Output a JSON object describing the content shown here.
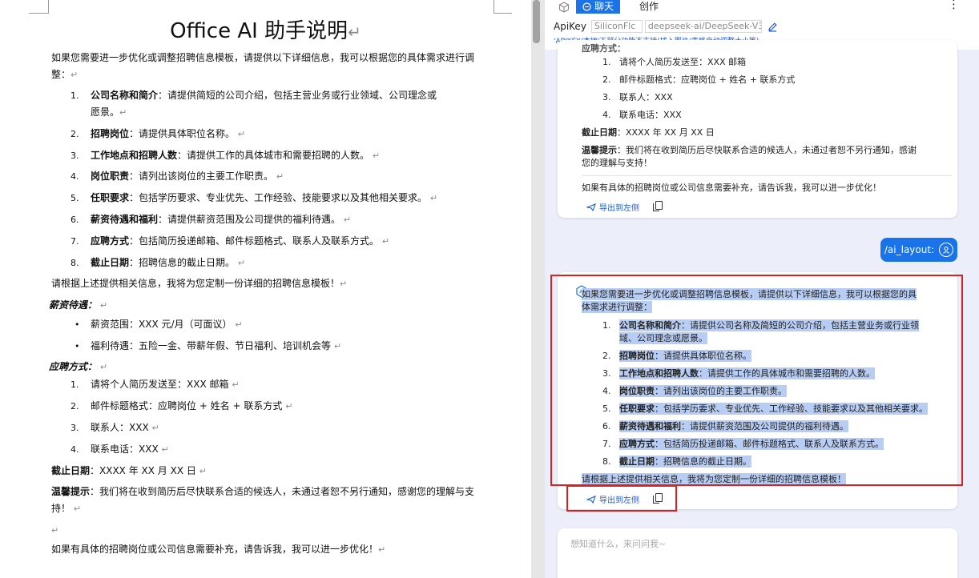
{
  "document": {
    "title": "Office AI 助手说明",
    "intro_1": "如果您需要进一步优化或调整招聘信息模板，请提供以下详细信息，我可以根据您的具体需求进行调",
    "intro_2": "整：",
    "items": [
      {
        "num": "1.",
        "label": "公司名称和简介",
        "text": "：请提供简短的公司介绍，包括主营业务或行业领域、公司理念或",
        "text2": "愿景。"
      },
      {
        "num": "2.",
        "label": "招聘岗位",
        "text": "：请提供具体职位名称。"
      },
      {
        "num": "3.",
        "label": "工作地点和招聘人数",
        "text": "：请提供工作的具体城市和需要招聘的人数。"
      },
      {
        "num": "4.",
        "label": "岗位职责",
        "text": "：请列出该岗位的主要工作职责。"
      },
      {
        "num": "5.",
        "label": "任职要求",
        "text": "：包括学历要求、专业优先、工作经验、技能要求以及其他相关要求。"
      },
      {
        "num": "6.",
        "label": "薪资待遇和福利",
        "text": "：请提供薪资范围及公司提供的福利待遇。"
      },
      {
        "num": "7.",
        "label": "应聘方式",
        "text": "：包括简历投递邮箱、邮件标题格式、联系人及联系方式。"
      },
      {
        "num": "8.",
        "label": "截止日期",
        "text": "：招聘信息的截止日期。"
      }
    ],
    "closing": "请根据上述提供相关信息，我将为您定制一份详细的招聘信息模板！",
    "salary_heading": "薪资待遇：",
    "salary_bullets": [
      {
        "mark": "•",
        "text": "薪资范围：XXX 元/月（可面议）"
      },
      {
        "mark": "•",
        "text": "福利待遇：五险一金、带薪年假、节日福利、培训机会等"
      }
    ],
    "apply_heading": "应聘方式：",
    "apply_items": [
      {
        "num": "1.",
        "text": "请将个人简历发送至：XXX 邮箱"
      },
      {
        "num": "2.",
        "text": "邮件标题格式：应聘岗位 + 姓名 + 联系方式"
      },
      {
        "num": "3.",
        "text": "联系人：XXX"
      },
      {
        "num": "4.",
        "text": "联系电话：XXX"
      }
    ],
    "deadline_label": "截止日期",
    "deadline_text": "：XXXX 年 XX 月 XX 日",
    "reminder_label": "温馨提示",
    "reminder_text": "：我们将在收到简历后尽快联系合适的候选人，未通过者恕不另行通知，感谢您的理解与支",
    "reminder_text2": "持！",
    "final_line": "如果有具体的招聘岗位或公司信息需要补充，请告诉我，我可以进一步优化！",
    "para_mark": "↵"
  },
  "panel": {
    "tabs": {
      "chat": "聊天",
      "create": "创作"
    },
    "more": "⋮",
    "api": {
      "label": "ApiKey",
      "provider": "SiliconFlc",
      "model": "deepseek-ai/DeepSeek-V3",
      "note": "'APIKEY/本地'下部分功能不支持(插入图片/表格自动调整大小等)"
    },
    "card1": {
      "partial_heading": "应聘方式：",
      "items": [
        {
          "num": "1.",
          "text": "请将个人简历发送至：XXX 邮箱"
        },
        {
          "num": "2.",
          "text": "邮件标题格式：应聘岗位 + 姓名 + 联系方式"
        },
        {
          "num": "3.",
          "text": "联系人：XXX"
        },
        {
          "num": "4.",
          "text": "联系电话：XXX"
        }
      ],
      "deadline_label": "截止日期",
      "deadline_text": "：XXXX 年 XX 月 XX 日",
      "reminder_label": "温馨提示",
      "reminder_text": "：我们将在收到简历后尽快联系合适的候选人，未通过者恕不另行通知，感谢",
      "reminder_text2": "您的理解与支持！",
      "followup": "如果有具体的招聘岗位或公司信息需要补充，请告诉我，我可以进一步优化！",
      "export_label": "导出到左侧"
    },
    "user_message": "/ai_layout:",
    "card2": {
      "ai_badge": "AI",
      "intro_1": "如果您需要进一步优化或调整招聘信息模板，请提供以下详细信息，我可以根据您的具",
      "intro_2": "体需求进行调整：",
      "items": [
        {
          "num": "1.",
          "label": "公司名称和简介",
          "text": "：请提供公司名称及简短的公司介绍，包括主营业务或行业领",
          "text2": "域、公司理念或愿景。"
        },
        {
          "num": "2.",
          "label": "招聘岗位",
          "text": "：请提供具体职位名称。"
        },
        {
          "num": "3.",
          "label": "工作地点和招聘人数",
          "text": "：请提供工作的具体城市和需要招聘的人数。"
        },
        {
          "num": "4.",
          "label": "岗位职责",
          "text": "：请列出该岗位的主要工作职责。"
        },
        {
          "num": "5.",
          "label": "任职要求",
          "text": "：包括学历要求、专业优先、工作经验、技能要求以及其他相关要求。"
        },
        {
          "num": "6.",
          "label": "薪资待遇和福利",
          "text": "：请提供薪资范围及公司提供的福利待遇。"
        },
        {
          "num": "7.",
          "label": "应聘方式",
          "text": "：包括简历投递邮箱、邮件标题格式、联系人及联系方式。"
        },
        {
          "num": "8.",
          "label": "截止日期",
          "text": "：招聘信息的截止日期。"
        }
      ],
      "closing": "请根据上述提供相关信息，我将为您定制一份详细的招聘信息模板！",
      "export_label": "导出到左侧"
    },
    "input_placeholder": "想知道什么，来问问我~",
    "colors": {
      "accent": "#1a73e8",
      "highlight": "#b8cdf3",
      "annotation": "#e02020",
      "panel_bg": "#eceff9"
    }
  }
}
